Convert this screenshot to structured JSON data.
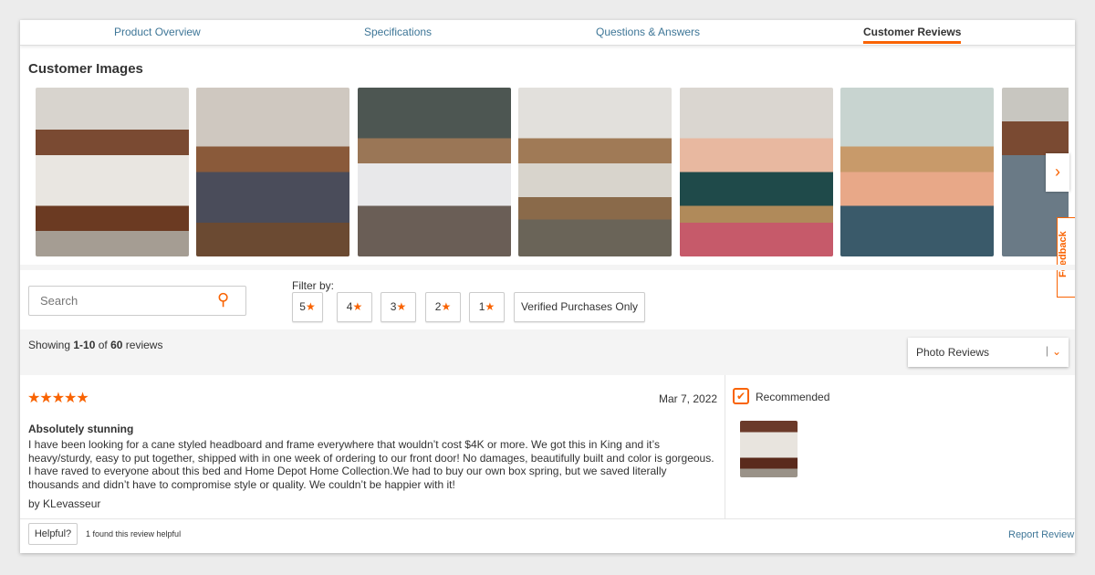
{
  "tabs": [
    {
      "label": "Product Overview"
    },
    {
      "label": "Specifications"
    },
    {
      "label": "Questions & Answers"
    },
    {
      "label": "Customer Reviews",
      "active": true
    }
  ],
  "customer_images": {
    "title": "Customer Images",
    "count_visible": 7,
    "next_icon": "chevron-right-icon"
  },
  "feedback": {
    "label": "Feedback"
  },
  "search": {
    "placeholder": "Search",
    "icon": "search-icon"
  },
  "filter": {
    "label": "Filter by:",
    "star": "★",
    "options": [
      "5",
      "4",
      "3",
      "2",
      "1"
    ],
    "verified": "Verified Purchases Only"
  },
  "summary": {
    "prefix": "Showing ",
    "range": "1-10",
    "mid": " of ",
    "total": "60",
    "suffix": " reviews"
  },
  "sort": {
    "selected": "Photo Reviews"
  },
  "review": {
    "stars": "★★★★★",
    "rating": 5,
    "date": "Mar 7, 2022",
    "title": "Absolutely stunning",
    "body": "I have been looking for a cane styled headboard and frame everywhere that wouldn’t cost $4K or more. We got this in King and it’s heavy/sturdy, easy to put together, shipped with in one week of ordering to our front door! No damages, beautifully built and color is gorgeous. I have raved to everyone about this bed and Home Depot Home Collection.We had to buy our own box spring, but we saved literally thousands and didn’t have to compromise style or quality. We couldn’t be happier with it!",
    "by_prefix": "by ",
    "author": "KLevasseur",
    "recommended": "Recommended",
    "helpful_button": "Helpful?",
    "helpful_count": "1 found this review helpful",
    "report": "Report Review"
  },
  "colors": {
    "accent": "#f96302",
    "link": "#3e7697"
  }
}
